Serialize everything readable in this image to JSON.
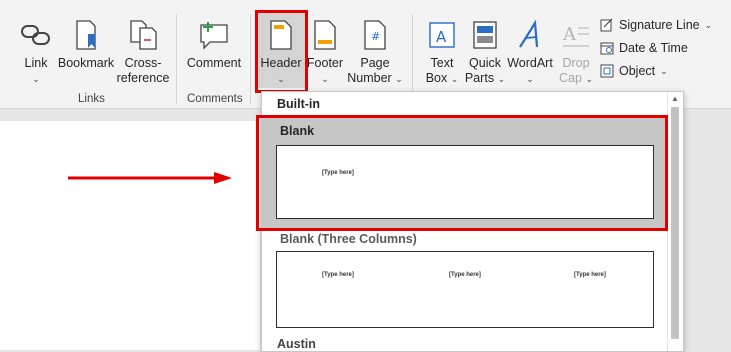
{
  "ribbon": {
    "link": {
      "label": "Link"
    },
    "bookmark": {
      "label": "Bookmark"
    },
    "crossref": {
      "line1": "Cross-",
      "line2": "reference"
    },
    "comment": {
      "label": "Comment"
    },
    "header": {
      "label": "Header"
    },
    "footer": {
      "label": "Footer"
    },
    "page_number": {
      "line1": "Page",
      "line2": "Number"
    },
    "text_box": {
      "line1": "Text",
      "line2": "Box"
    },
    "quick_parts": {
      "line1": "Quick",
      "line2": "Parts"
    },
    "wordart": {
      "label": "WordArt"
    },
    "drop_cap": {
      "line1": "Drop",
      "line2": "Cap"
    },
    "signature_line": {
      "label": "Signature Line"
    },
    "date_time": {
      "label": "Date & Time"
    },
    "object": {
      "label": "Object"
    },
    "groups": {
      "links": "Links",
      "comments": "Comments"
    },
    "chevron": "⌄",
    "dropdown_arrow": "⌄"
  },
  "dropdown": {
    "section_builtin": "Built-in",
    "items": [
      {
        "title": "Blank",
        "placeholders": [
          "[Type here]"
        ]
      },
      {
        "title": "Blank (Three Columns)",
        "placeholders": [
          "[Type here]",
          "[Type here]",
          "[Type here]"
        ]
      },
      {
        "title": "Austin"
      }
    ]
  },
  "colors": {
    "highlight": "#e00000",
    "accent_blue": "#2b6cc4",
    "selected_bg": "#c6c6c6"
  }
}
